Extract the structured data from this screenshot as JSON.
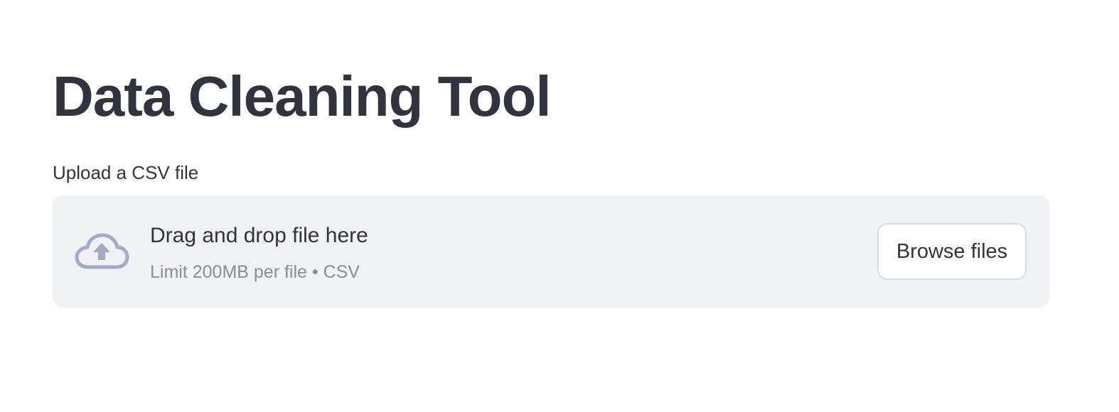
{
  "page": {
    "title": "Data Cleaning Tool"
  },
  "uploader": {
    "label": "Upload a CSV file",
    "drop_text": "Drag and drop file here",
    "limit_text": "Limit 200MB per file • CSV",
    "browse_label": "Browse files",
    "icon": "cloud-upload-icon"
  },
  "colors": {
    "text": "#31333f",
    "dropzone_bg": "#f0f2f6",
    "icon": "#a3abc6",
    "muted_text": "#8a8d96"
  }
}
